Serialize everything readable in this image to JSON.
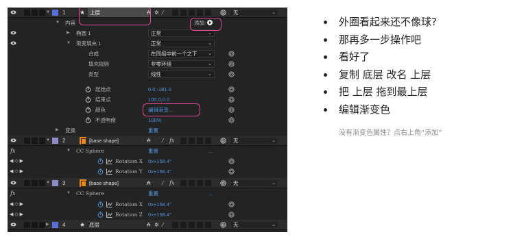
{
  "timeline": {
    "layer_upper": {
      "number": "1",
      "name": "上层",
      "mode": "无"
    },
    "contents": {
      "label": "内容",
      "add_label": "添加:"
    },
    "ellipse": {
      "label": "椭圆 1",
      "blend": "正常"
    },
    "gradient_fill": {
      "label": "渐变填充 1",
      "blend": "正常",
      "composite": {
        "label": "合成",
        "value": "在同组中前一个之下"
      },
      "fill_rule": {
        "label": "填充规则",
        "value": "非零环绕"
      },
      "type": {
        "label": "类型",
        "value": "线性"
      },
      "start_point": {
        "label": "起始点",
        "value": "0.0,-181.0"
      },
      "end_point": {
        "label": "结束点",
        "value": "100.0,0.0"
      },
      "colors": {
        "label": "颜色",
        "value": "编辑渐变..."
      },
      "opacity": {
        "label": "不透明度",
        "value": "100%"
      }
    },
    "transform": {
      "label": "变换",
      "value": "重置"
    },
    "layer_base_2": {
      "number": "2",
      "name": "[base shape]",
      "mode": "无"
    },
    "fx_2": {
      "label": "fx",
      "effect": "CC Sphere",
      "reset": "重置",
      "dots": "...",
      "rot_x": {
        "label": "Rotation X",
        "value": "0x+158.4°"
      },
      "rot_y": {
        "label": "Rotation Y",
        "value": "0x+158.4°"
      }
    },
    "layer_base_3": {
      "number": "3",
      "name": "[base shape]",
      "mode": "无"
    },
    "fx_3": {
      "label": "fx",
      "effect": "CC Sphere",
      "reset": "重置",
      "dots": "...",
      "rot_x": {
        "label": "Rotation X",
        "value": "0x+158.4°"
      },
      "rot_z": {
        "label": "Rotation Z",
        "value": "0x+158.4°"
      }
    },
    "layer_lower": {
      "number": "4",
      "name": "底层",
      "mode": "无"
    }
  },
  "notes": {
    "bullets": [
      "外圈看起来还不像球?",
      "那再多一步操作吧",
      "看好了",
      "复制 底层 改名 上层",
      "把 上层 拖到最上层",
      "编辑渐变色"
    ],
    "hint": "没有渐变色属性？点右上角“添加”"
  },
  "colors": {
    "panel_bg": "#232323",
    "layer_row": "#2c2c2c",
    "value_blue": "#4f95d9",
    "highlight_pink": "#e44a92",
    "label_blue": "#5b6dd6",
    "label_lavender": "#8c8cc8",
    "ai_orange": "#e88b1c"
  }
}
